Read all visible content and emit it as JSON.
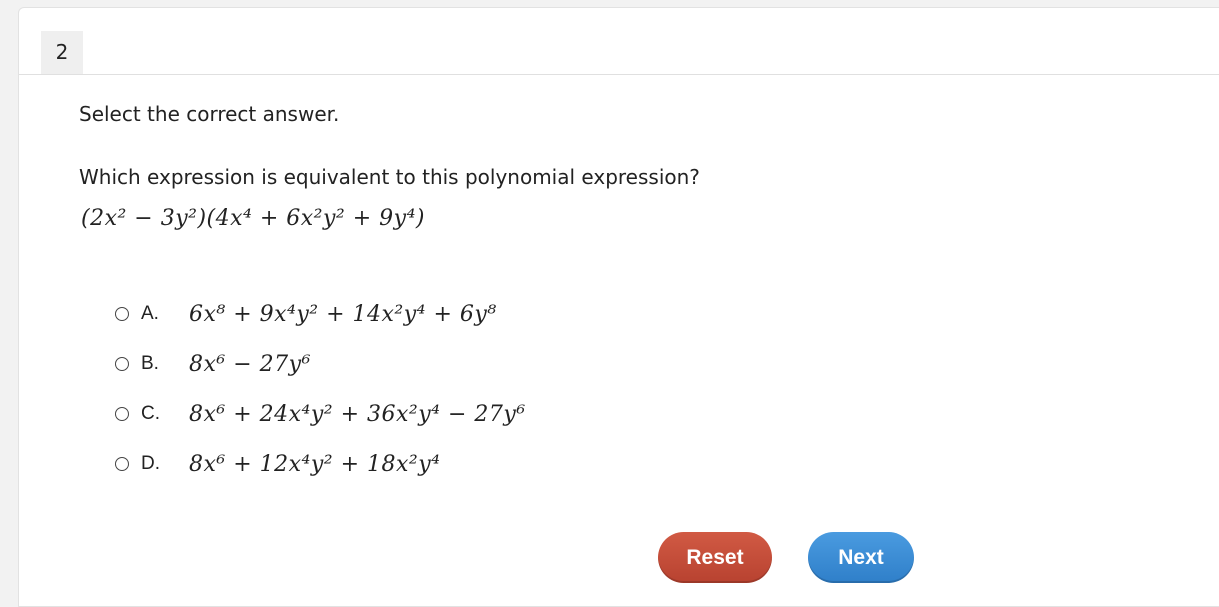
{
  "question": {
    "number": "2",
    "instruction": "Select the correct answer.",
    "prompt": "Which expression is equivalent to this polynomial expression?",
    "expression": "(2x² − 3y²)(4x⁴ + 6x²y² + 9y⁴)"
  },
  "options": [
    {
      "letter": "A.",
      "text": "6x⁸ + 9x⁴y² + 14x²y⁴ + 6y⁸"
    },
    {
      "letter": "B.",
      "text": "8x⁶ − 27y⁶"
    },
    {
      "letter": "C.",
      "text": "8x⁶ + 24x⁴y² + 36x²y⁴ − 27y⁶"
    },
    {
      "letter": "D.",
      "text": "8x⁶ + 12x⁴y² + 18x²y⁴"
    }
  ],
  "buttons": {
    "reset_label": "Reset",
    "next_label": "Next"
  },
  "colors": {
    "reset": "#c44d39",
    "next": "#3b8ed6",
    "background": "#f2f2f2"
  }
}
